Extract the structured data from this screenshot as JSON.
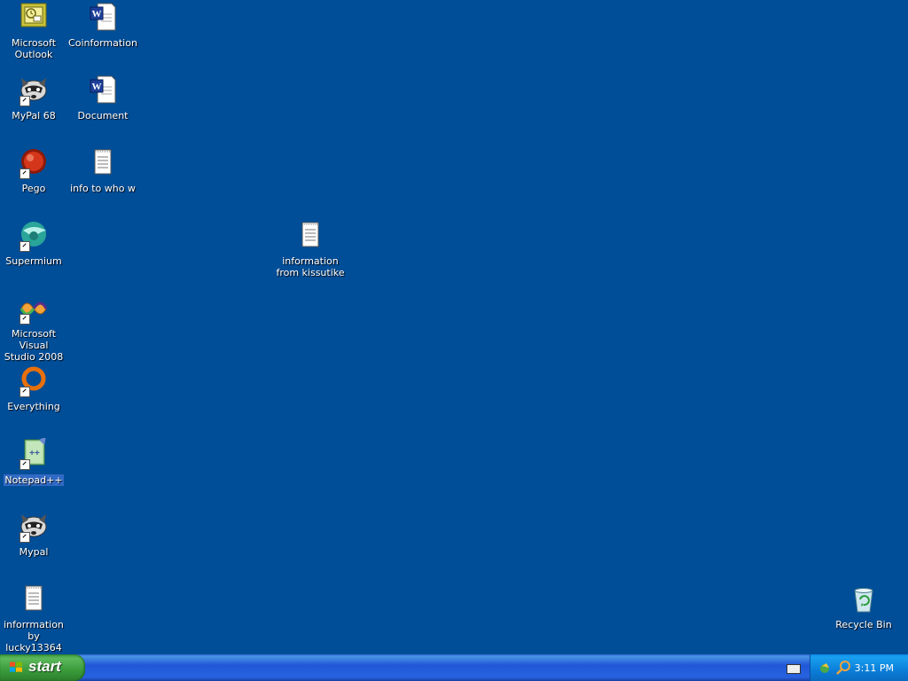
{
  "desktop": {
    "background_color": "#004e98",
    "icons": [
      {
        "id": "outlook",
        "label": "Microsoft\nOutlook",
        "icon": "outlook-icon"
      },
      {
        "id": "coinformation",
        "label": "Coinformation",
        "icon": "word-document-icon"
      },
      {
        "id": "mypal68",
        "label": "MyPal 68",
        "icon": "raccoon-icon"
      },
      {
        "id": "document",
        "label": "Document",
        "icon": "word-document-icon"
      },
      {
        "id": "pego",
        "label": "Pego",
        "icon": "pego-icon"
      },
      {
        "id": "info-to-who",
        "label": "info to who w",
        "icon": "notepad-document-icon"
      },
      {
        "id": "supermium",
        "label": "Supermium",
        "icon": "supermium-icon"
      },
      {
        "id": "info-kissutike",
        "label": "information\nfrom kissutike",
        "icon": "notepad-document-icon"
      },
      {
        "id": "visual-studio",
        "label": "Microsoft Visual\nStudio 2008",
        "icon": "visual-studio-icon"
      },
      {
        "id": "everything",
        "label": "Everything",
        "icon": "everything-icon"
      },
      {
        "id": "notepadpp",
        "label": "Notepad++",
        "icon": "notepadpp-icon",
        "selected": true
      },
      {
        "id": "mypal",
        "label": "Mypal",
        "icon": "raccoon-icon"
      },
      {
        "id": "info-lucky",
        "label": "inforrmation by\nlucky13364",
        "icon": "notepad-document-icon"
      },
      {
        "id": "recycle-bin",
        "label": "Recycle Bin",
        "icon": "recycle-bin-icon"
      }
    ]
  },
  "taskbar": {
    "start_label": "start",
    "clock": "3:11 PM",
    "tray_icons": [
      "keyboard-icon",
      "network-icon",
      "search-icon"
    ]
  }
}
